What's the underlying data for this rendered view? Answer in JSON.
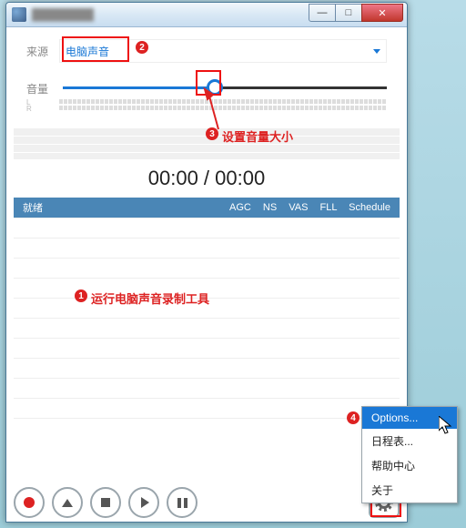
{
  "window": {
    "title": "████████",
    "controls": {
      "min": "—",
      "max": "□",
      "close": "✕"
    }
  },
  "source": {
    "label": "来源",
    "value": "电脑声音"
  },
  "volume": {
    "label": "音量",
    "left_channel": "L",
    "right_channel": "R",
    "position_percent": 47
  },
  "time_display": "00:00 / 00:00",
  "status": {
    "left": "就绪",
    "indicators": [
      "AGC",
      "NS",
      "VAS",
      "FLL",
      "Schedule"
    ]
  },
  "annotations": {
    "step1": "运行电脑声音录制工具",
    "step2_badge": "2",
    "step3": "设置音量大小",
    "step4_badge": "4",
    "badge1": "1",
    "badge3": "3"
  },
  "context_menu": {
    "items": [
      "Options...",
      "日程表...",
      "帮助中心",
      "关于"
    ],
    "selected_index": 0
  }
}
